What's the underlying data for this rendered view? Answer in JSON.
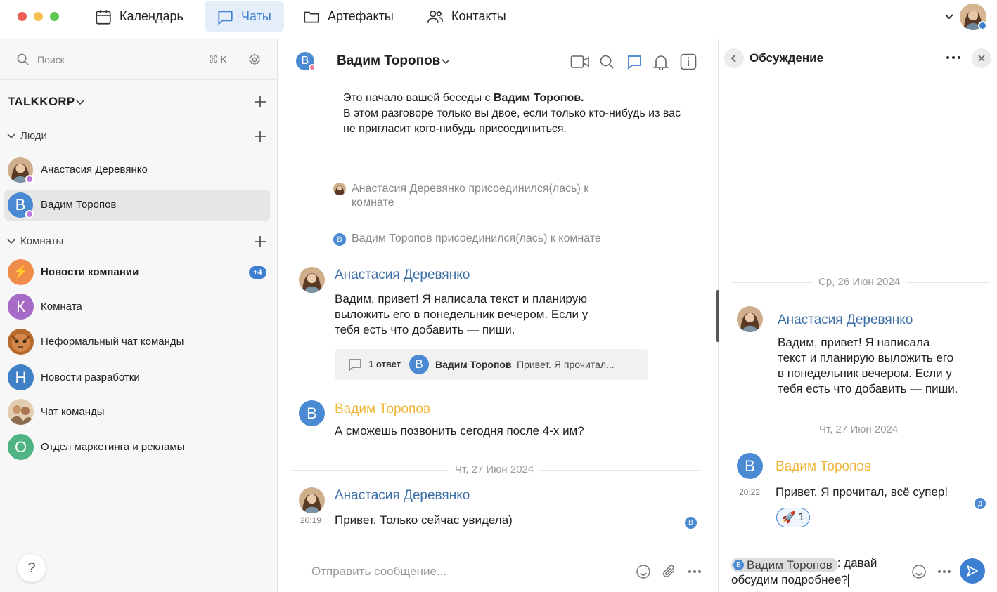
{
  "nav": {
    "tabs": [
      {
        "label": "Календарь",
        "icon": "calendar-icon"
      },
      {
        "label": "Чаты",
        "icon": "chat-icon"
      },
      {
        "label": "Артефакты",
        "icon": "folder-icon"
      },
      {
        "label": "Контакты",
        "icon": "contacts-icon"
      }
    ],
    "accent": "#3d7fd1"
  },
  "sidebar": {
    "search_placeholder": "Поиск",
    "search_shortcut": "⌘ K",
    "workspace": "TALKKORP",
    "people_header": "Люди",
    "people": [
      {
        "label": "Анастасия Деревянко",
        "initial": ""
      },
      {
        "label": "Вадим Торопов",
        "initial": "В"
      }
    ],
    "rooms_header": "Комнаты",
    "rooms": [
      {
        "label": "Новости компании",
        "initial": "⚡",
        "badge": "+4",
        "color": "#f08c4a"
      },
      {
        "label": "Комната",
        "initial": "К",
        "color": "#a66bc6"
      },
      {
        "label": "Неформальный чат команды",
        "initial": "",
        "color": "#c27a3a"
      },
      {
        "label": "Новости разработки",
        "initial": "Н",
        "color": "#3f80c6"
      },
      {
        "label": "Чат команды",
        "initial": "",
        "color": "#c9a77c"
      },
      {
        "label": "Отдел маркетинга и рекламы",
        "initial": "О",
        "color": "#4db482"
      }
    ],
    "help": "?"
  },
  "chat": {
    "title": "Вадим Торопов",
    "title_initial": "В",
    "intro_line1_prefix": "Это начало вашей беседы с ",
    "intro_line1_name": "Вадим Торопов.",
    "intro_line2": "В этом разговоре только вы двое, если только кто-нибудь из вас",
    "intro_line3": "не пригласит кого-нибудь присоединиться.",
    "sys1_line1": "Анастасия Деревянко присоединился(лась) к",
    "sys1_line2": "комнате",
    "sys2": "Вадим Торопов присоединился(лась) к комнате",
    "sys2_initial": "В",
    "messages": [
      {
        "author": "Анастасия Деревянко",
        "lines": [
          "Вадим, привет! Я написала текст и планирую",
          "выложить его в понедельник вечером. Если у",
          "тебя есть что добавить — пиши."
        ]
      },
      {
        "author": "Вадим Торопов",
        "initial": "В",
        "lines": [
          "А сможешь позвонить сегодня после 4-х им?"
        ]
      },
      {
        "author": "Анастасия Деревянко",
        "time": "20:19",
        "lines": [
          "Привет. Только сейчас увидела)"
        ],
        "read_initial": "В"
      }
    ],
    "thread_summary": {
      "count": "1 ответ",
      "initial": "В",
      "author": "Вадим Торопов",
      "preview": "Привет. Я прочитал..."
    },
    "date_sep": "Чт, 27 Июн 2024",
    "composer_placeholder": "Отправить сообщение..."
  },
  "thread": {
    "title": "Обсуждение",
    "date1": "Ср, 26 Июн 2024",
    "msg1_author": "Анастасия Деревянко",
    "msg1_lines": [
      "Вадим, привет! Я написала",
      "текст и планирую выложить его",
      "в понедельник вечером. Если у",
      "тебя есть что добавить — пиши."
    ],
    "date2": "Чт, 27 Июн 2024",
    "msg2_author": "Вадим Торопов",
    "msg2_initial": "В",
    "msg2_time": "20:22",
    "msg2_text": "Привет. Я прочитал, всё супер!",
    "reaction_emoji": "🚀",
    "reaction_count": "1",
    "read_initial": "Д",
    "composer_mention_initial": "В",
    "composer_mention": "Вадим Торопов",
    "composer_text1": ": давай",
    "composer_text2": "обсудим подробнее?"
  }
}
